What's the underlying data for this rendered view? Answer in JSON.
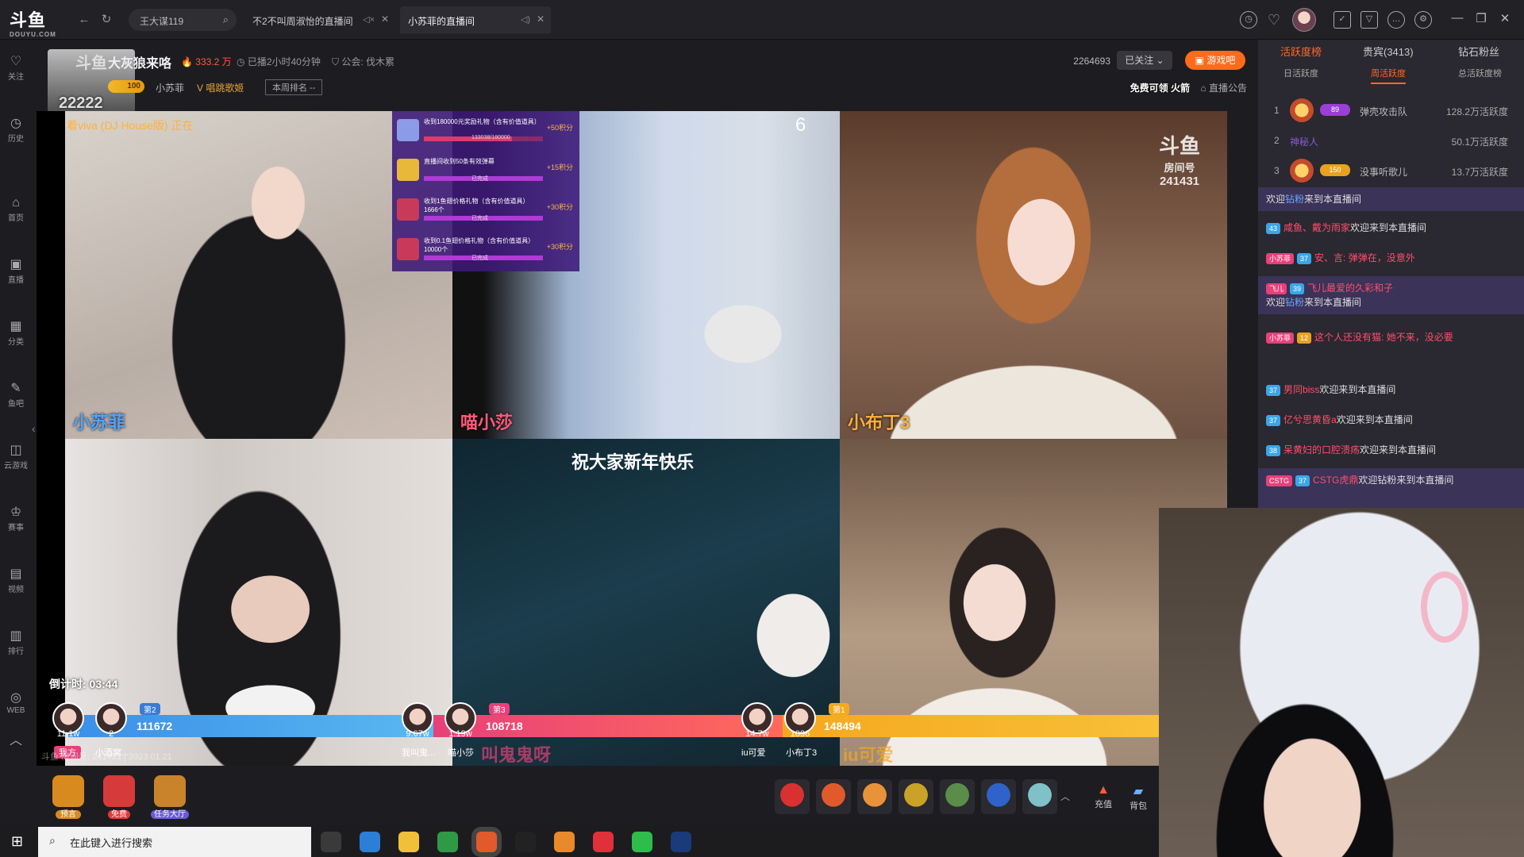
{
  "titlebar": {
    "logo": "斗鱼",
    "logo_sub": "DOUYU.COM",
    "search_tab": "王大谋119",
    "tabs": [
      {
        "label": "不2不叫周淑怡的直播间"
      },
      {
        "label": "小苏菲的直播间"
      }
    ],
    "icons": [
      "history-icon",
      "heart-icon",
      "calendar-icon",
      "shirt-icon",
      "message-icon",
      "settings-icon"
    ]
  },
  "sidebar": [
    {
      "label": "关注",
      "icon": "heart-icon"
    },
    {
      "label": "历史",
      "icon": "clock-icon"
    },
    {
      "label": "首页",
      "icon": "home-icon"
    },
    {
      "label": "直播",
      "icon": "live-icon"
    },
    {
      "label": "分类",
      "icon": "grid-icon"
    },
    {
      "label": "鱼吧",
      "icon": "fish-icon"
    },
    {
      "label": "云游戏",
      "icon": "gamepad-icon"
    },
    {
      "label": "赛事",
      "icon": "trophy-icon"
    },
    {
      "label": "视频",
      "icon": "video-icon"
    },
    {
      "label": "排行",
      "icon": "rank-icon"
    },
    {
      "label": "WEB",
      "icon": "web-icon"
    }
  ],
  "room": {
    "avatar_logo": "斗鱼",
    "avatar_number": "22222",
    "title": "大灰狼来咯",
    "hot": "333.2 万",
    "live_time": "已播2小时40分钟",
    "guild": "公会: 伐木累",
    "level": "100",
    "anchor": "小苏菲",
    "tag": "唱跳歌姬",
    "week_rank": "本周排名 --",
    "fans_count": "2264693",
    "follow": "已关注",
    "game": "游戏吧",
    "free_fire": "免费可领 火箭",
    "notice": "直播公告"
  },
  "video": {
    "song": "着viva (DJ House版) 正在",
    "tasks": [
      {
        "text": "收到180000元奖励礼物（含有价值道具）",
        "progress": "133038/180000",
        "points": "+50积分",
        "status": "",
        "fill": 0.74
      },
      {
        "text": "直播间收到50条有效弹幕",
        "progress": "",
        "points": "+15积分",
        "status": "已完成",
        "fill": 1
      },
      {
        "text": "收到1鱼翅价格礼物（含有价值道具）1666个",
        "progress": "",
        "points": "+30积分",
        "status": "已完成",
        "fill": 1
      },
      {
        "text": "收到0.1鱼翅价格礼物（含有价值道具）10000个",
        "progress": "",
        "points": "+30积分",
        "status": "已完成",
        "fill": 1
      }
    ],
    "counter": "6",
    "room_logo": "斗鱼",
    "room_logo_sub": "房间号",
    "room_no": "241431",
    "names": [
      "小苏菲",
      "喵小莎",
      "小布丁3"
    ],
    "banner": "祝大家新年快乐",
    "countdown": "倒计时: 03:44",
    "watermark": "斗鱼 房间号: 241431 | 2023.01.21",
    "pk": [
      {
        "rank": "第2",
        "score": "111672",
        "color": "#4aa3e8",
        "left": {
          "val": "11.1w",
          "label": "我方"
        },
        "right": {
          "val": "2",
          "label": "小酒窝..."
        }
      },
      {
        "rank": "第3",
        "score": "108718",
        "color": "#e8507a",
        "left": {
          "val": "9.67w",
          "label": "我叫鬼..."
        },
        "right": {
          "val": "1.19w",
          "label": "喵小莎"
        }
      },
      {
        "rank": "第1",
        "score": "148494",
        "color": "#f59a1f",
        "left": {
          "val": "14.7w",
          "label": "iu可爱"
        },
        "right": {
          "val": "1096",
          "label": "小布丁3"
        }
      }
    ],
    "bottom_names": [
      "叫鬼鬼呀",
      "iu可爱"
    ]
  },
  "giftbar": {
    "left": [
      {
        "label": "预言"
      },
      {
        "label": "免费"
      },
      {
        "label": "任务大厅"
      }
    ],
    "charge": "充值",
    "bag": "背包",
    "gift_colors": [
      "#d8312f",
      "#e05a2b",
      "#e8923a",
      "#c9a227",
      "#5a8d4a",
      "#2f63c9",
      "#7fc0c9"
    ]
  },
  "rightpanel": {
    "tabs": [
      "活跃度榜",
      "贵宾(3413)",
      "钻石粉丝"
    ],
    "subtabs": [
      "日活跃度",
      "周活跃度",
      "总活跃度榜"
    ],
    "ranks": [
      {
        "no": "1",
        "lvl": "89",
        "name": "弹壳攻击队",
        "value": "128.2万活跃度"
      },
      {
        "no": "2",
        "lvl": "",
        "name": "神秘人",
        "value": "50.1万活跃度"
      },
      {
        "no": "3",
        "lvl": "150",
        "name": "没事听歌儿",
        "value": "13.7万活跃度"
      }
    ],
    "chat": [
      {
        "pre": "欢迎",
        "nick": "钻粉",
        "text": "来到本直播间"
      },
      {
        "lvl": "43",
        "nick": "咸鱼、戴为雨家",
        "text": "欢迎来到本直播间"
      },
      {
        "badge": "小苏菲",
        "lvl": "37",
        "nick": "安、言:",
        "text": "弹弹在，没意外"
      },
      {
        "badge": "飞儿",
        "lvl": "39",
        "nick": "飞儿最爱的久彩和子",
        "text": ""
      },
      {
        "pre": "欢迎",
        "nick": "钻粉",
        "text": "来到本直播间"
      },
      {
        "badge": "小苏菲",
        "lvl": "12",
        "nick": "这个人还没有猫:",
        "text": "她不来，没必要"
      },
      {
        "lvl": "37",
        "nick": "男同biss",
        "text": "欢迎来到本直播间"
      },
      {
        "lvl": "37",
        "nick": "亿兮思黄昏a",
        "text": "欢迎来到本直播间"
      },
      {
        "lvl": "38",
        "nick": "呆黄妇的口腔溃疡",
        "text": "欢迎来到本直播间"
      },
      {
        "badge": "CSTG",
        "lvl": "37",
        "nick": "CSTG虎鼎",
        "text": "欢迎钻粉来到本直播间"
      }
    ]
  },
  "taskbar": {
    "search": "在此键入进行搜索",
    "apps": [
      "#3a3a3a",
      "#2b7fd6",
      "#f0c038",
      "#2f9a46",
      "#e05a2b",
      "#222",
      "#e8892b",
      "#e0303a",
      "#2ebd4a",
      "#1a3a7a"
    ]
  }
}
